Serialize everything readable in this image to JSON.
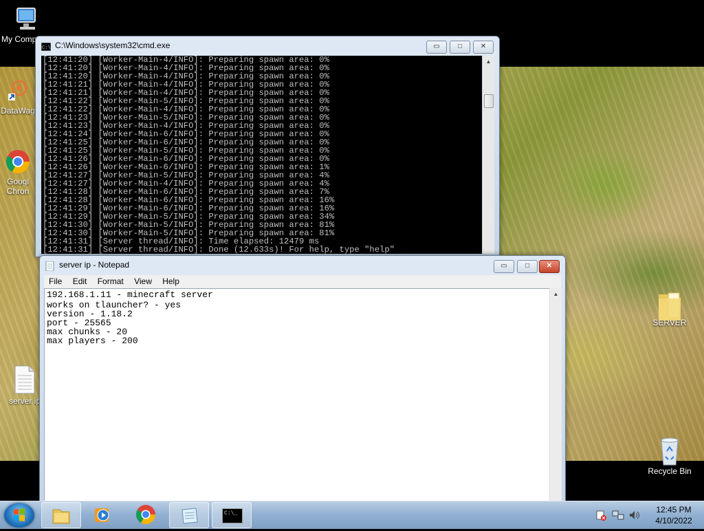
{
  "desktop": {
    "icons": [
      {
        "label": "My Comp"
      },
      {
        "label": "DataWag"
      },
      {
        "label": "Googl",
        "label2": "Chron"
      },
      {
        "label": "server ip"
      },
      {
        "label": "SERVER"
      },
      {
        "label": "Recycle Bin"
      }
    ]
  },
  "cmd": {
    "title": "C:\\Windows\\system32\\cmd.exe",
    "lines": [
      "[12:41:20] [Worker-Main-4/INFO]: Preparing spawn area: 0%",
      "[12:41:20] [Worker-Main-4/INFO]: Preparing spawn area: 0%",
      "[12:41:20] [Worker-Main-4/INFO]: Preparing spawn area: 0%",
      "[12:41:21] [Worker-Main-4/INFO]: Preparing spawn area: 0%",
      "[12:41:21] [Worker-Main-4/INFO]: Preparing spawn area: 0%",
      "[12:41:22] [Worker-Main-5/INFO]: Preparing spawn area: 0%",
      "[12:41:22] [Worker-Main-4/INFO]: Preparing spawn area: 0%",
      "[12:41:23] [Worker-Main-5/INFO]: Preparing spawn area: 0%",
      "[12:41:23] [Worker-Main-4/INFO]: Preparing spawn area: 0%",
      "[12:41:24] [Worker-Main-6/INFO]: Preparing spawn area: 0%",
      "[12:41:25] [Worker-Main-6/INFO]: Preparing spawn area: 0%",
      "[12:41:25] [Worker-Main-5/INFO]: Preparing spawn area: 0%",
      "[12:41:26] [Worker-Main-6/INFO]: Preparing spawn area: 0%",
      "[12:41:26] [Worker-Main-6/INFO]: Preparing spawn area: 1%",
      "[12:41:27] [Worker-Main-5/INFO]: Preparing spawn area: 4%",
      "[12:41:27] [Worker-Main-4/INFO]: Preparing spawn area: 4%",
      "[12:41:28] [Worker-Main-6/INFO]: Preparing spawn area: 7%",
      "[12:41:28] [Worker-Main-6/INFO]: Preparing spawn area: 16%",
      "[12:41:29] [Worker-Main-6/INFO]: Preparing spawn area: 16%",
      "[12:41:29] [Worker-Main-5/INFO]: Preparing spawn area: 34%",
      "[12:41:30] [Worker-Main-5/INFO]: Preparing spawn area: 81%",
      "[12:41:30] [Worker-Main-5/INFO]: Preparing spawn area: 81%",
      "[12:41:31] [Server thread/INFO]: Time elapsed: 12479 ms",
      "[12:41:31] [Server thread/INFO]: Done (12.633s)! For help, type \"help\""
    ]
  },
  "notepad": {
    "title": "server ip - Notepad",
    "menu": [
      "File",
      "Edit",
      "Format",
      "View",
      "Help"
    ],
    "lines": [
      "192.168.1.11 - minecraft server",
      "works on tlauncher? - yes",
      "version - 1.18.2",
      "port - 25565",
      "max chunks - 20",
      "max players - 200"
    ]
  },
  "window_controls": {
    "minimize": "▭",
    "maximize": "□",
    "close": "✕"
  },
  "taskbar": {
    "clock_time": "12:45 PM",
    "clock_date": "4/10/2022",
    "cmd_glyph": "C:\\_"
  }
}
